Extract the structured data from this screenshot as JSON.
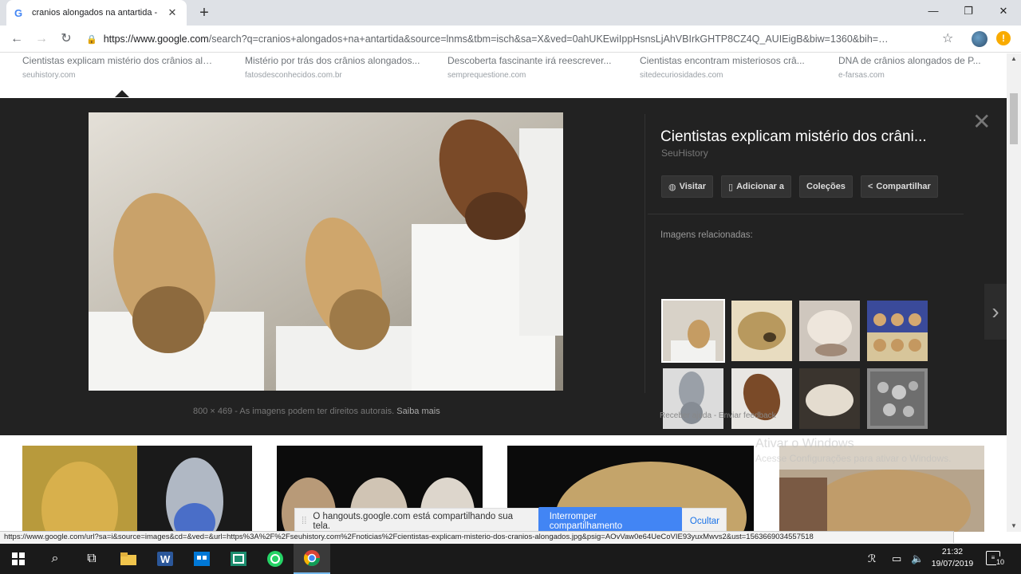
{
  "browser": {
    "tab_icon": "G",
    "tab_title": "cranios alongados na antartida -",
    "url_host": "https://www.google.com",
    "url_path": "/search?q=cranios+alongados+na+antartida&source=lnms&tbm=isch&sa=X&ved=0ahUKEwiIppHsnsLjAhVBIrkGHTP8CZ4Q_AUIEigB&biw=1360&bih=…",
    "update_badge": "!"
  },
  "result_row": [
    {
      "title": "Cientistas explicam mistério dos crânios alo...",
      "domain": "seuhistory.com"
    },
    {
      "title": "Mistério por trás dos crânios alongados...",
      "domain": "fatosdesconhecidos.com.br"
    },
    {
      "title": "Descoberta fascinante irá reescrever...",
      "domain": "semprequestione.com"
    },
    {
      "title": "Cientistas encontram misteriosos crâ...",
      "domain": "sitedecuriosidades.com"
    },
    {
      "title": "DNA de crânios alongados de P...",
      "domain": "e-farsas.com"
    }
  ],
  "preview": {
    "title": "Cientistas explicam mistério dos crâni...",
    "source": "SeuHistory",
    "size": "800 × 469",
    "rights_text": " - As imagens podem ter direitos autorais.",
    "learn_more": " Saiba mais",
    "actions": [
      {
        "icon": "globe-icon",
        "label": "Visitar"
      },
      {
        "icon": "bookmark-icon",
        "label": "Adicionar a"
      },
      {
        "icon": "",
        "label": "Coleções"
      },
      {
        "icon": "share-icon",
        "label": "Compartilhar"
      }
    ],
    "related_label": "Imagens relacionadas:",
    "feedback": "Receber ajuda - Enviar feedback"
  },
  "watermark": {
    "line1": "Ativar o Windows",
    "line2": "Acesse Configurações para ativar o Windows."
  },
  "hangouts_bar": {
    "message": "O hangouts.google.com está compartilhando sua tela.",
    "stop_label": "Interromper compartilhamento",
    "hide_label": "Ocultar"
  },
  "status_url": "https://www.google.com/url?sa=i&source=images&cd=&ved=&url=https%3A%2F%2Fseuhistory.com%2Fnoticias%2Fcientistas-explicam-misterio-dos-cranios-alongados.jpg&psig=AOvVaw0e64UeCoVIE93yuxMwvs2&ust=1563669034557518",
  "taskbar": {
    "time": "21:32",
    "date": "19/07/2019",
    "notifications": "10"
  }
}
